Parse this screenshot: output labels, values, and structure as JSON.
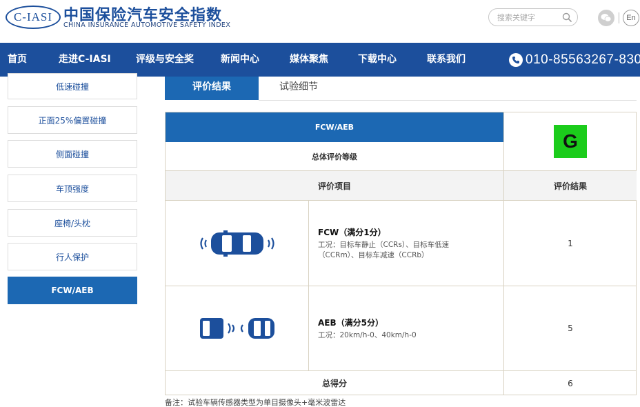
{
  "header": {
    "logo_mark": "C-IASI",
    "logo_cn": "中国保险汽车安全指数",
    "logo_en": "CHINA INSURANCE AUTOMOTIVE SAFETY INDEX",
    "search_placeholder": "搜索关键字",
    "search_icon": "search-icon",
    "wechat_icon": "wechat-icon",
    "lang_label": "En"
  },
  "nav": {
    "items": [
      "首页",
      "走进C-IASI",
      "评级与安全奖",
      "新闻中心",
      "媒体聚焦",
      "下载中心",
      "联系我们"
    ],
    "phone": "010-85563267-830"
  },
  "sidebar": {
    "items": [
      {
        "label": "低速碰撞",
        "active": false
      },
      {
        "label": "正面25%偏置碰撞",
        "active": false
      },
      {
        "label": "侧面碰撞",
        "active": false
      },
      {
        "label": "车顶强度",
        "active": false
      },
      {
        "label": "座椅/头枕",
        "active": false
      },
      {
        "label": "行人保护",
        "active": false
      },
      {
        "label": "FCW/AEB",
        "active": true
      }
    ]
  },
  "tabs": [
    {
      "label": "评价结果",
      "active": true
    },
    {
      "label": "试验细节",
      "active": false
    }
  ],
  "table": {
    "section_title": "FCW/AEB",
    "overall_label": "总体评价等级",
    "overall_grade": "G",
    "grade_color": "#1bcc1b",
    "col_item": "评价项目",
    "col_result": "评价结果",
    "rows": [
      {
        "title": "FCW（满分1分）",
        "desc": "工况：目标车静止（CCRs）、目标车低速（CCRm）、目标车减速（CCRb）",
        "result": "1",
        "icon": "car-radar-icon"
      },
      {
        "title": "AEB（满分5分）",
        "desc": "工况：20km/h-0、40km/h-0",
        "result": "5",
        "icon": "car-following-icon"
      }
    ],
    "total_label": "总得分",
    "total_value": "6"
  },
  "note": "备注：试验车辆传感器类型为单目摄像头+毫米波雷达",
  "colors": {
    "brand_blue": "#1c4f9c",
    "accent_blue": "#1c68b3"
  }
}
